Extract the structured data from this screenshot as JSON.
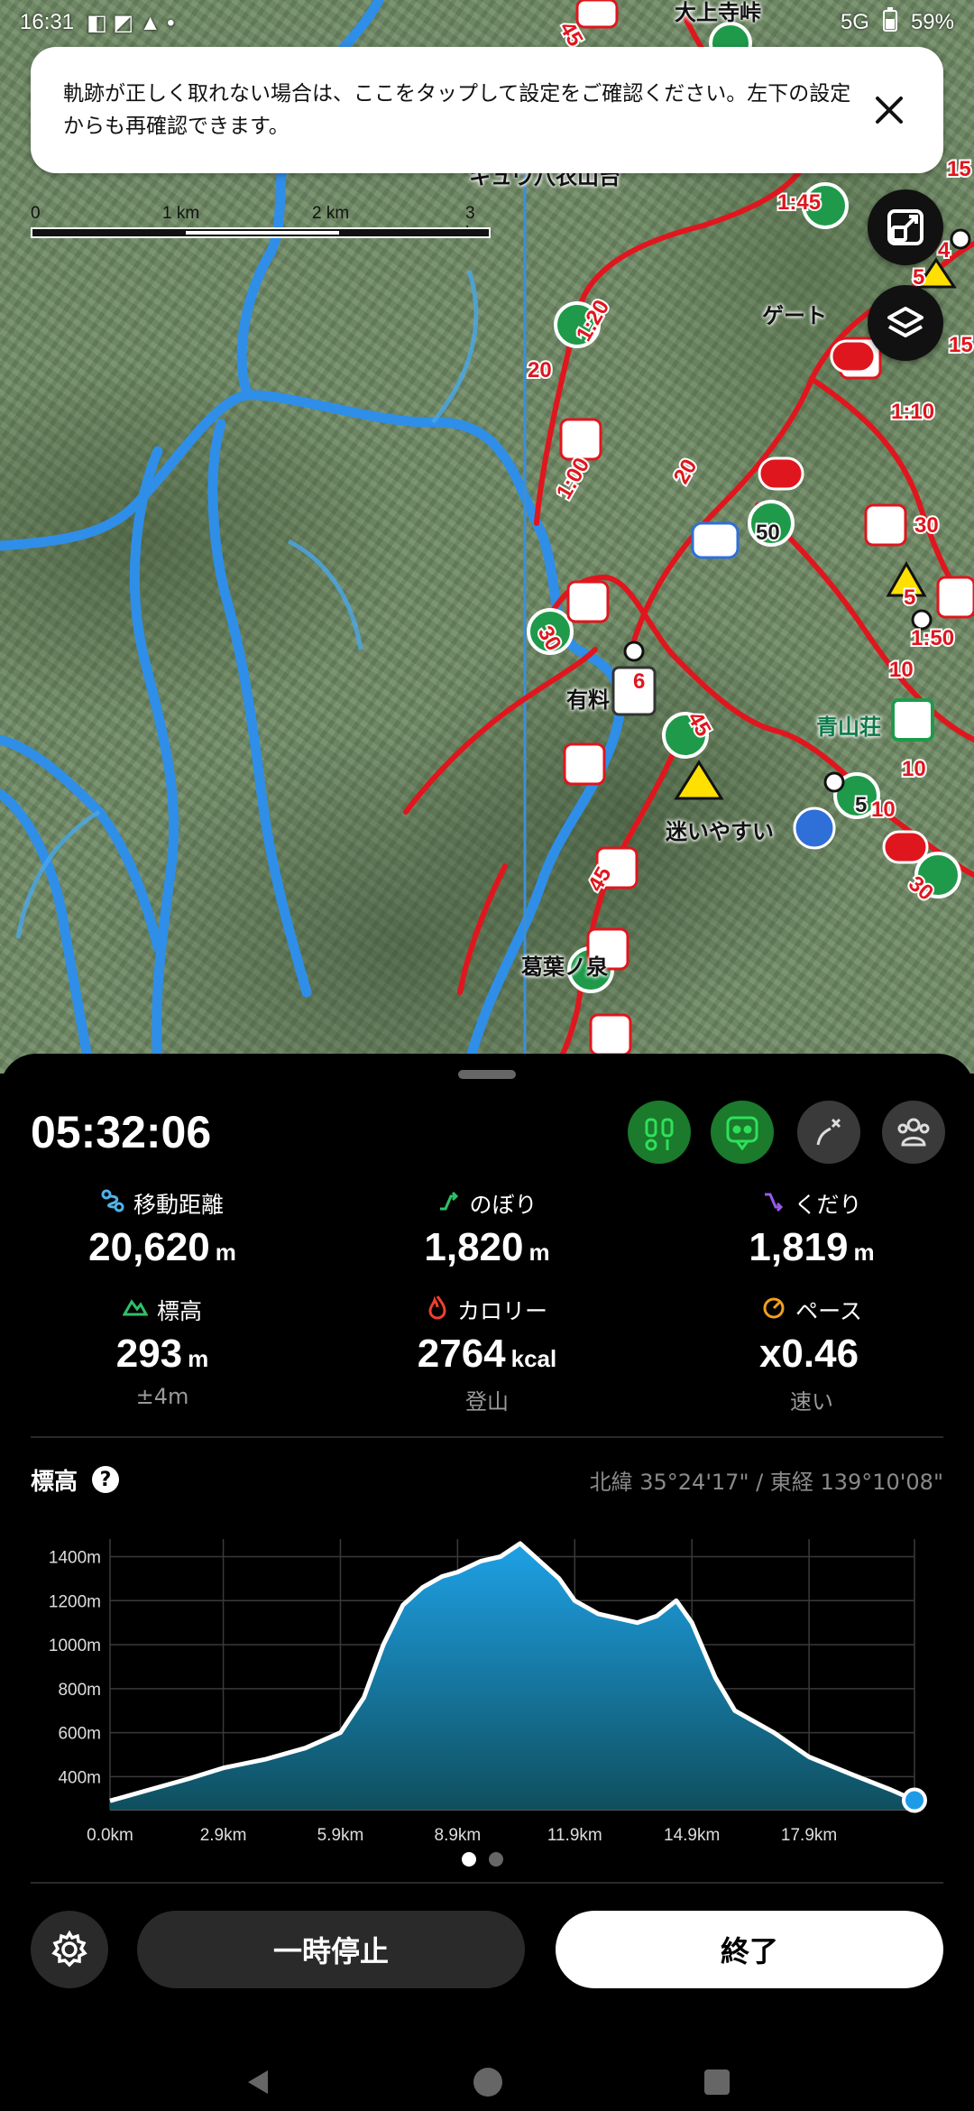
{
  "status_bar": {
    "time": "16:31",
    "battery": "59%",
    "network": "5G"
  },
  "banner": {
    "message": "軌跡が正しく取れない場合は、ここをタップして設定をご確認ください。左下の設定からも再確認できます。"
  },
  "scale": {
    "labels": [
      "0",
      "1 km",
      "2 km",
      "3 km"
    ]
  },
  "map_labels": {
    "top_place": "大上寺峠",
    "gate": "ゲート",
    "paid": "有料",
    "easy_to_get_lost": "迷いやすい",
    "aoyama_so": "青山荘",
    "kuzuha_no_izumi": "葛葉ノ泉",
    "cut_top": "キュウ八衣山台"
  },
  "route_numbers": [
    "45",
    "1:45",
    "1:20",
    "20",
    "1:00",
    "20",
    "50",
    "30",
    "6",
    "45",
    "10",
    "5",
    "30",
    "45",
    "15",
    "1:10",
    "30",
    "5",
    "1:50",
    "10",
    "10",
    "15",
    "4",
    "5"
  ],
  "activity": {
    "elapsed": "05:32:06",
    "stats": [
      {
        "label": "移動距離",
        "value": "20,620",
        "unit": "m",
        "sub": ""
      },
      {
        "label": "のぼり",
        "value": "1,820",
        "unit": "m",
        "sub": ""
      },
      {
        "label": "くだり",
        "value": "1,819",
        "unit": "m",
        "sub": ""
      },
      {
        "label": "標高",
        "value": "293",
        "unit": "m",
        "sub": "±4m"
      },
      {
        "label": "カロリー",
        "value": "2764",
        "unit": "kcal",
        "sub": "登山"
      },
      {
        "label": "ペース",
        "value": "x0.46",
        "unit": "",
        "sub": "速い"
      }
    ]
  },
  "elevation": {
    "title": "標高",
    "help": "?",
    "coordinates": "北緯 35°24'17\" / 東経 139°10'08\""
  },
  "chart_data": {
    "type": "area",
    "title": "",
    "xlabel": "",
    "ylabel": "",
    "x_ticks": [
      "0.0km",
      "2.9km",
      "5.9km",
      "8.9km",
      "11.9km",
      "14.9km",
      "17.9km"
    ],
    "y_ticks": [
      "400m",
      "600m",
      "800m",
      "1000m",
      "1200m",
      "1400m"
    ],
    "xlim": [
      0,
      20.6
    ],
    "ylim": [
      250,
      1480
    ],
    "x": [
      0,
      1,
      2,
      2.9,
      4,
      5,
      5.9,
      6.5,
      7,
      7.5,
      8,
      8.5,
      8.9,
      9.5,
      10,
      10.5,
      11,
      11.5,
      11.9,
      12.5,
      13,
      13.5,
      14,
      14.5,
      14.9,
      15.5,
      16,
      17,
      17.9,
      19,
      20,
      20.6
    ],
    "y": [
      290,
      340,
      390,
      440,
      480,
      530,
      600,
      760,
      1000,
      1180,
      1260,
      1310,
      1330,
      1380,
      1400,
      1460,
      1380,
      1300,
      1200,
      1140,
      1120,
      1100,
      1130,
      1200,
      1100,
      850,
      700,
      600,
      490,
      410,
      340,
      293
    ],
    "current_position": {
      "x": 20.6,
      "y": 293
    }
  },
  "pager": {
    "pages": 2,
    "active": 0
  },
  "controls": {
    "pause_label": "一時停止",
    "end_label": "終了"
  },
  "colors": {
    "route_red": "#e0161e",
    "river_blue": "#2f8ee8",
    "chart_fill_top": "#1ea1e6",
    "chart_fill_bottom": "#0f4f5e",
    "accent_green": "#1b7a2c"
  },
  "icons": [
    "battery-icon",
    "close-icon",
    "expand-map-icon",
    "layers-icon",
    "distance-icon",
    "ascent-icon",
    "descent-icon",
    "altitude-icon",
    "calorie-icon",
    "pace-icon",
    "help-icon",
    "settings-icon",
    "back-nav-icon",
    "home-nav-icon",
    "recents-nav-icon"
  ]
}
